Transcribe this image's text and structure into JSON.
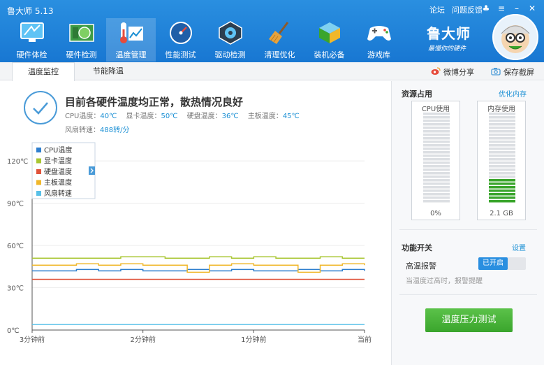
{
  "app": {
    "title": "鲁大师 5.13"
  },
  "title_links": [
    "论坛",
    "问题反馈"
  ],
  "toolbar": {
    "items": [
      {
        "label": "硬件体检",
        "icon": "monitor-icon",
        "active": false
      },
      {
        "label": "硬件检测",
        "icon": "circuit-board-icon",
        "active": false
      },
      {
        "label": "温度管理",
        "icon": "thermometer-icon",
        "active": true
      },
      {
        "label": "性能测试",
        "icon": "speedometer-icon",
        "active": false
      },
      {
        "label": "驱动检测",
        "icon": "gear-chip-icon",
        "active": false
      },
      {
        "label": "清理优化",
        "icon": "broom-icon",
        "active": false
      },
      {
        "label": "装机必备",
        "icon": "cube-icon",
        "active": false
      },
      {
        "label": "游戏库",
        "icon": "gamepad-icon",
        "active": false
      }
    ]
  },
  "brand": {
    "name": "鲁大师",
    "slogan": "最懂你的硬件"
  },
  "tabs": [
    {
      "label": "温度监控",
      "active": true
    },
    {
      "label": "节能降温",
      "active": false
    }
  ],
  "actions": {
    "share": "微博分享",
    "screenshot": "保存截屏"
  },
  "status": {
    "title": "目前各硬件温度均正常，散热情况良好",
    "temps": [
      {
        "label": "CPU温度：",
        "value": "40℃"
      },
      {
        "label": "显卡温度：",
        "value": "50℃"
      },
      {
        "label": "硬盘温度：",
        "value": "36℃"
      },
      {
        "label": "主板温度：",
        "value": "45℃"
      }
    ],
    "fan_label": "风扇转速：",
    "fan_value": "488转/分"
  },
  "chart_data": {
    "type": "line",
    "x_ticks": [
      "3分钟前",
      "2分钟前",
      "1分钟前",
      "当前"
    ],
    "y_ticks": [
      "0℃",
      "30℃",
      "60℃",
      "90℃",
      "120℃"
    ],
    "ylim": [
      0,
      130
    ],
    "grid": true,
    "legend_position": "top-left",
    "x": [
      0,
      0.2,
      0.4,
      0.6,
      0.8,
      1.0,
      1.2,
      1.4,
      1.6,
      1.8,
      2.0,
      2.2,
      2.4,
      2.6,
      2.8,
      3.0
    ],
    "series": [
      {
        "name": "CPU温度",
        "color": "#2e7fcf",
        "values": [
          42,
          42,
          43,
          42,
          43,
          42,
          42,
          43,
          42,
          43,
          42,
          42,
          43,
          42,
          43,
          42
        ]
      },
      {
        "name": "显卡温度",
        "color": "#a8c632",
        "values": [
          51,
          51,
          51,
          51,
          52,
          52,
          51,
          51,
          52,
          51,
          52,
          51,
          51,
          52,
          51,
          51
        ]
      },
      {
        "name": "硬盘温度",
        "color": "#e0533b",
        "values": [
          36,
          36,
          36,
          36,
          36,
          36,
          36,
          36,
          36,
          36,
          36,
          36,
          36,
          36,
          36,
          36
        ]
      },
      {
        "name": "主板温度",
        "color": "#f0b72a",
        "values": [
          46,
          46,
          47,
          46,
          47,
          46,
          46,
          41,
          46,
          47,
          46,
          46,
          41,
          46,
          47,
          46
        ]
      },
      {
        "name": "风扇转速",
        "color": "#57c0e8",
        "values": [
          4,
          4,
          4,
          4,
          4,
          4,
          4,
          4,
          4,
          4,
          4,
          4,
          4,
          4,
          4,
          4
        ]
      }
    ]
  },
  "resources": {
    "title": "资源占用",
    "optimize": "优化内存",
    "cpu": {
      "label": "CPU使用",
      "value": "0%",
      "fraction": 0.0
    },
    "mem": {
      "label": "内存使用",
      "value": "2.1 GB",
      "fraction": 0.27
    }
  },
  "functions": {
    "title": "功能开关",
    "settings": "设置",
    "high_temp_alarm": "高温报警",
    "toggle": "已开启",
    "hint": "当温度过高时，报警提醒",
    "stress_button": "温度压力测试"
  },
  "colors": {
    "accent": "#1a8fd4",
    "topbar": "#1877d2",
    "green": "#3aa52c"
  }
}
